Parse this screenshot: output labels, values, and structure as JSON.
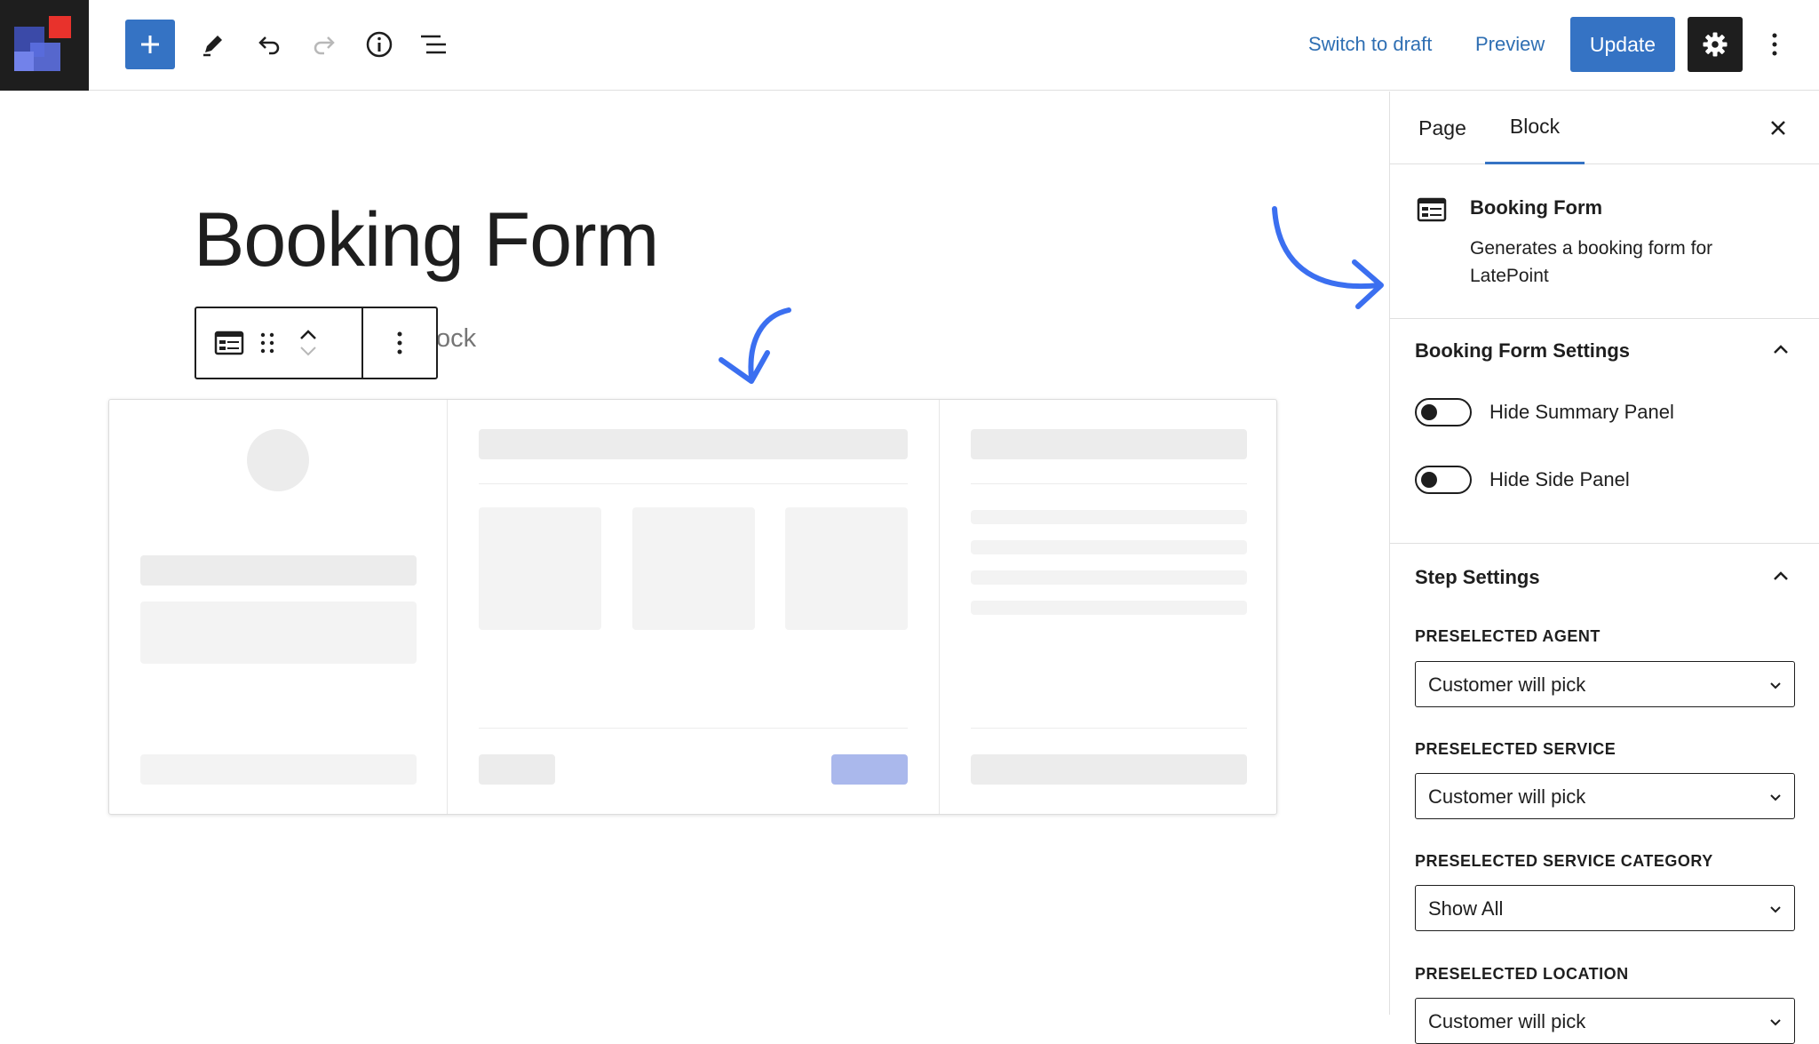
{
  "toolbar": {
    "switch_to_draft": "Switch to draft",
    "preview": "Preview",
    "update": "Update",
    "icons": [
      "plus-icon",
      "pencil-icon",
      "undo-icon",
      "redo-icon",
      "info-icon",
      "list-view-icon",
      "gear-icon",
      "kebab-icon"
    ]
  },
  "editor": {
    "page_title": "Booking Form",
    "partial_text": "ock"
  },
  "sidebar": {
    "tabs": [
      {
        "label": "Page"
      },
      {
        "label": "Block"
      }
    ],
    "active_tab": "Block",
    "block": {
      "name": "Booking Form",
      "description": "Generates a booking form for LatePoint"
    },
    "booking_form_settings": {
      "title": "Booking Form Settings",
      "toggles": [
        {
          "label": "Hide Summary Panel",
          "on": false
        },
        {
          "label": "Hide Side Panel",
          "on": false
        }
      ]
    },
    "step_settings": {
      "title": "Step Settings",
      "fields": [
        {
          "label": "PRESELECTED AGENT",
          "value": "Customer will pick"
        },
        {
          "label": "PRESELECTED SERVICE",
          "value": "Customer will pick"
        },
        {
          "label": "PRESELECTED SERVICE CATEGORY",
          "value": "Show All"
        },
        {
          "label": "PRESELECTED LOCATION",
          "value": "Customer will pick"
        }
      ]
    }
  },
  "colors": {
    "accent": "#3573c4",
    "link": "#2f6fb3",
    "dark": "#1e1e1e",
    "logo_red": "#e8322c",
    "logo_blue": "#5c6fe0",
    "annotation_arrow": "#3b6ff0"
  }
}
